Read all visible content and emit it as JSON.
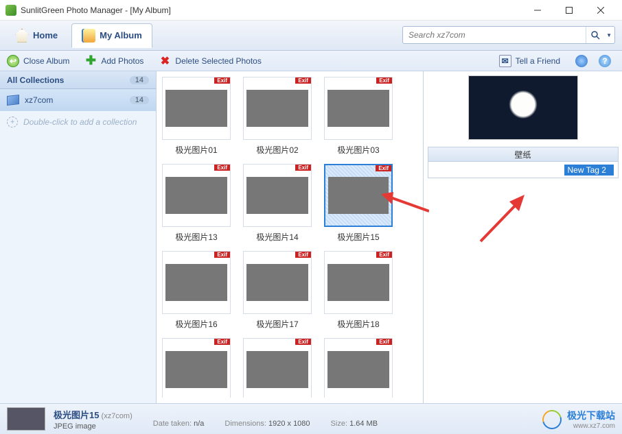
{
  "title": "SunlitGreen Photo Manager - [My Album]",
  "tabs": {
    "home": "Home",
    "album": "My Album"
  },
  "search": {
    "placeholder": "Search xz7com"
  },
  "commands": {
    "close_album": "Close Album",
    "add_photos": "Add Photos",
    "delete_selected": "Delete Selected Photos",
    "tell_friend": "Tell a Friend"
  },
  "sidebar": {
    "header": "All Collections",
    "header_count": "14",
    "items": [
      {
        "label": "xz7com",
        "count": "14"
      }
    ],
    "add_hint": "Double-click to add a collection"
  },
  "thumbs": [
    {
      "name": "极光图片01",
      "cls": "p1"
    },
    {
      "name": "极光图片02",
      "cls": "p2"
    },
    {
      "name": "极光图片03",
      "cls": "p3"
    },
    {
      "name": "极光图片13",
      "cls": "p4"
    },
    {
      "name": "极光图片14",
      "cls": "p5"
    },
    {
      "name": "极光图片15",
      "cls": "p6",
      "selected": true
    },
    {
      "name": "极光图片16",
      "cls": "p7"
    },
    {
      "name": "极光图片17",
      "cls": "p8"
    },
    {
      "name": "极光图片18",
      "cls": "p9"
    },
    {
      "name": "",
      "cls": "p10"
    },
    {
      "name": "",
      "cls": "p11"
    },
    {
      "name": "",
      "cls": "p12"
    }
  ],
  "exif_badge": "Exif",
  "rightpanel": {
    "tag_section_label": "壁纸",
    "tag_edit_value": "New Tag 2"
  },
  "status": {
    "name": "极光图片15",
    "collection": "(xz7com)",
    "type": "JPEG image",
    "date_label": "Date taken:",
    "date_value": "n/a",
    "dim_label": "Dimensions:",
    "dim_value": "1920 x 1080",
    "size_label": "Size:",
    "size_value": "1.64 MB"
  },
  "brand": {
    "name": "极光下载站",
    "url": "www.xz7.com"
  }
}
